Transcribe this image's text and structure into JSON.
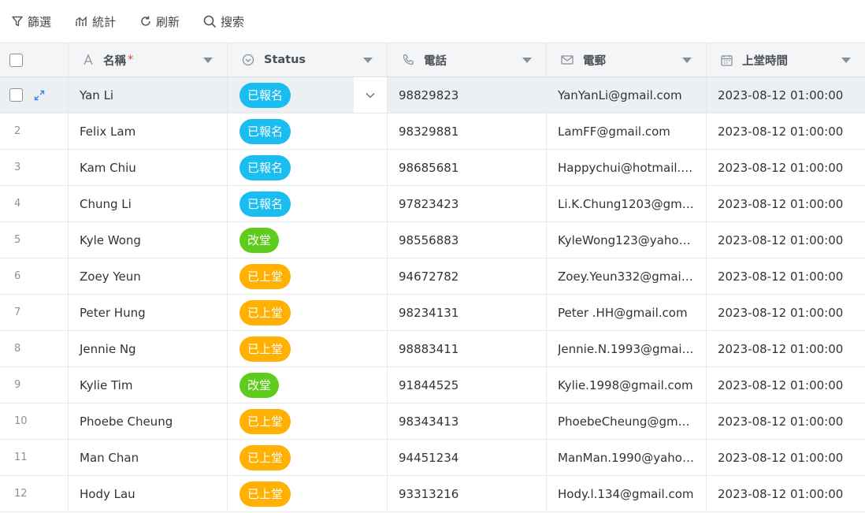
{
  "toolbar": {
    "filter_label": "篩選",
    "stats_label": "統計",
    "refresh_label": "刷新",
    "search_label": "搜索"
  },
  "columns": {
    "name": "名稱",
    "required_mark": "*",
    "status": "Status",
    "phone": "電話",
    "email": "電郵",
    "time": "上堂時間"
  },
  "status_colors": {
    "registered": "#19bdf0",
    "changed": "#5fcb1c",
    "attended": "#ffb000"
  },
  "rows": [
    {
      "num": "",
      "name": "Yan Li",
      "status": "已報名",
      "status_key": "registered",
      "phone": "98829823",
      "email": "YanYanLi@gmail.com",
      "time": "2023-08-12 01:00:00"
    },
    {
      "num": "2",
      "name": "Felix Lam",
      "status": "已報名",
      "status_key": "registered",
      "phone": "98329881",
      "email": "LamFF@gmail.com",
      "time": "2023-08-12 01:00:00"
    },
    {
      "num": "3",
      "name": "Kam Chiu",
      "status": "已報名",
      "status_key": "registered",
      "phone": "98685681",
      "email": "Happychui@hotmail.c...",
      "time": "2023-08-12 01:00:00"
    },
    {
      "num": "4",
      "name": "Chung Li",
      "status": "已報名",
      "status_key": "registered",
      "phone": "97823423",
      "email": "Li.K.Chung1203@gmail...",
      "time": "2023-08-12 01:00:00"
    },
    {
      "num": "5",
      "name": "Kyle Wong",
      "status": "改堂",
      "status_key": "changed",
      "phone": "98556883",
      "email": "KyleWong123@yahoo....",
      "time": "2023-08-12 01:00:00"
    },
    {
      "num": "6",
      "name": "Zoey Yeun",
      "status": "已上堂",
      "status_key": "attended",
      "phone": "94672782",
      "email": "Zoey.Yeun332@gmail.c...",
      "time": "2023-08-12 01:00:00"
    },
    {
      "num": "7",
      "name": "Peter Hung",
      "status": "已上堂",
      "status_key": "attended",
      "phone": "98234131",
      "email": "Peter .HH@gmail.com",
      "time": "2023-08-12 01:00:00"
    },
    {
      "num": "8",
      "name": "Jennie Ng",
      "status": "已上堂",
      "status_key": "attended",
      "phone": "98883411",
      "email": "Jennie.N.1993@gmail.c...",
      "time": "2023-08-12 01:00:00"
    },
    {
      "num": "9",
      "name": "Kylie Tim",
      "status": "改堂",
      "status_key": "changed",
      "phone": "91844525",
      "email": "Kylie.1998@gmail.com",
      "time": "2023-08-12 01:00:00"
    },
    {
      "num": "10",
      "name": "Phoebe Cheung",
      "status": "已上堂",
      "status_key": "attended",
      "phone": "98343413",
      "email": "PhoebeCheung@gmail...",
      "time": "2023-08-12 01:00:00"
    },
    {
      "num": "11",
      "name": "Man Chan",
      "status": "已上堂",
      "status_key": "attended",
      "phone": "94451234",
      "email": "ManMan.1990@yahoo...",
      "time": "2023-08-12 01:00:00"
    },
    {
      "num": "12",
      "name": "Hody Lau",
      "status": "已上堂",
      "status_key": "attended",
      "phone": "93313216",
      "email": "Hody.l.134@gmail.com",
      "time": "2023-08-12 01:00:00"
    }
  ]
}
